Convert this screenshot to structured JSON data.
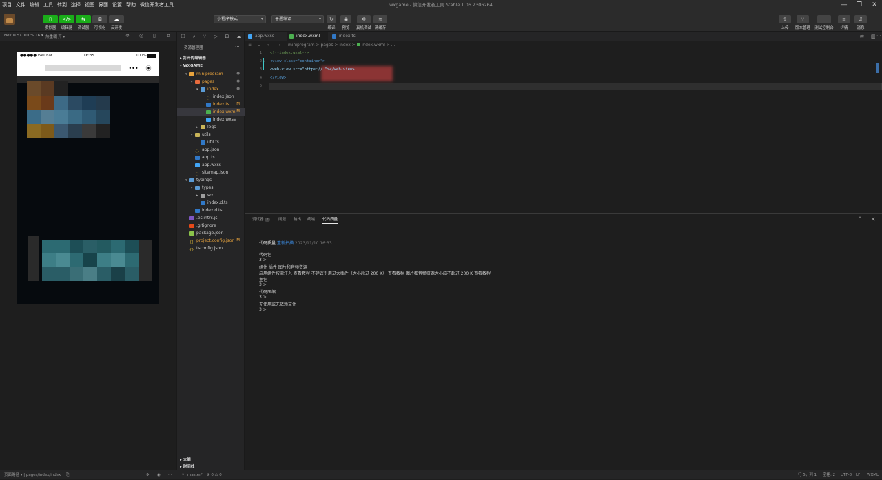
{
  "menu": [
    "项目",
    "文件",
    "编辑",
    "工具",
    "转到",
    "选择",
    "视图",
    "界面",
    "设置",
    "帮助",
    "微信开发者工具"
  ],
  "window_title": "wxgame - 微信开发者工具 Stable 1.06.2306264",
  "window_controls": [
    "—",
    "❐",
    "✕"
  ],
  "toolbar": {
    "left_buttons": [
      {
        "label": "模拟器",
        "icon": "phone-icon",
        "color": "#1aad19"
      },
      {
        "label": "编辑器",
        "icon": "code-icon",
        "color": "#1aad19"
      },
      {
        "label": "调试器",
        "icon": "debug-icon",
        "color": "#1aad19"
      },
      {
        "label": "可视化",
        "icon": "grid-icon",
        "color": "#444444"
      },
      {
        "label": "云开发",
        "icon": "cloud-icon",
        "color": "#444444"
      }
    ],
    "mode_select": "小程序模式",
    "compile_select": "普通编译",
    "mid_buttons": [
      "编译",
      "预览",
      "真机调试",
      "清缓存"
    ],
    "right_buttons": [
      "上传",
      "版本管理",
      "测试控制台",
      "详情",
      "消息"
    ]
  },
  "simulator": {
    "device": "Nexus 5X 100% 16 ▾",
    "hot_reload": "热重载 开 ▾",
    "status_carrier": "●●●●● WeChat",
    "status_time": "16:35",
    "status_battery": "100%",
    "capsule_more": "•••",
    "capsule_close": "⦿"
  },
  "explorer": {
    "title": "资源管理器",
    "open_editors": "打开的编辑器",
    "project": "WXGAME",
    "tree": [
      {
        "name": "miniprogram",
        "depth": 1,
        "twisty": "▾",
        "icon": "folder",
        "color": "#e8a33d",
        "badge": "●",
        "text_color": "#e8a33d"
      },
      {
        "name": "pages",
        "depth": 2,
        "twisty": "▾",
        "icon": "folder",
        "color": "#e86b3d",
        "badge": "●",
        "text_color": "#e8a33d"
      },
      {
        "name": "index",
        "depth": 3,
        "twisty": "▾",
        "icon": "folder",
        "color": "#5b9bd5",
        "badge": "●",
        "text_color": "#e8a33d"
      },
      {
        "name": "index.json",
        "depth": 4,
        "twisty": "",
        "icon": "json",
        "color": "#d9b53a",
        "badge": "",
        "text_color": "#cccccc"
      },
      {
        "name": "index.ts",
        "depth": 4,
        "twisty": "",
        "icon": "ts",
        "color": "#3178c6",
        "badge": "M",
        "text_color": "#e8a33d"
      },
      {
        "name": "index.wxml",
        "depth": 4,
        "twisty": "",
        "icon": "wxml",
        "color": "#4caf50",
        "badge": "M",
        "text_color": "#e8a33d",
        "selected": true
      },
      {
        "name": "index.wxss",
        "depth": 4,
        "twisty": "",
        "icon": "wxss",
        "color": "#42a5f5",
        "badge": "",
        "text_color": "#cccccc"
      },
      {
        "name": "logs",
        "depth": 3,
        "twisty": "▸",
        "icon": "folder",
        "color": "#c9b458",
        "badge": "",
        "text_color": "#cccccc"
      },
      {
        "name": "utils",
        "depth": 2,
        "twisty": "▾",
        "icon": "folder",
        "color": "#c9b458",
        "badge": "",
        "text_color": "#cccccc"
      },
      {
        "name": "util.ts",
        "depth": 3,
        "twisty": "",
        "icon": "ts",
        "color": "#3178c6",
        "badge": "",
        "text_color": "#cccccc"
      },
      {
        "name": "app.json",
        "depth": 2,
        "twisty": "",
        "icon": "json",
        "color": "#d9b53a",
        "badge": "",
        "text_color": "#cccccc"
      },
      {
        "name": "app.ts",
        "depth": 2,
        "twisty": "",
        "icon": "ts",
        "color": "#3178c6",
        "badge": "",
        "text_color": "#cccccc"
      },
      {
        "name": "app.wxss",
        "depth": 2,
        "twisty": "",
        "icon": "wxss",
        "color": "#42a5f5",
        "badge": "",
        "text_color": "#cccccc"
      },
      {
        "name": "sitemap.json",
        "depth": 2,
        "twisty": "",
        "icon": "json",
        "color": "#d9b53a",
        "badge": "",
        "text_color": "#cccccc"
      },
      {
        "name": "typings",
        "depth": 1,
        "twisty": "▾",
        "icon": "folder",
        "color": "#5b9bd5",
        "badge": "",
        "text_color": "#cccccc"
      },
      {
        "name": "types",
        "depth": 2,
        "twisty": "▾",
        "icon": "folder",
        "color": "#5b9bd5",
        "badge": "",
        "text_color": "#cccccc"
      },
      {
        "name": "wx",
        "depth": 3,
        "twisty": "▸",
        "icon": "folder",
        "color": "#9e9e9e",
        "badge": "",
        "text_color": "#cccccc"
      },
      {
        "name": "index.d.ts",
        "depth": 3,
        "twisty": "",
        "icon": "ts",
        "color": "#3178c6",
        "badge": "",
        "text_color": "#cccccc"
      },
      {
        "name": "index.d.ts",
        "depth": 2,
        "twisty": "",
        "icon": "ts",
        "color": "#3178c6",
        "badge": "",
        "text_color": "#cccccc"
      },
      {
        "name": ".eslintrc.js",
        "depth": 1,
        "twisty": "",
        "icon": "eslint",
        "color": "#7e57c2",
        "badge": "",
        "text_color": "#cccccc"
      },
      {
        "name": ".gitignore",
        "depth": 1,
        "twisty": "",
        "icon": "git",
        "color": "#e64a19",
        "badge": "",
        "text_color": "#cccccc"
      },
      {
        "name": "package.json",
        "depth": 1,
        "twisty": "",
        "icon": "npm",
        "color": "#8bc34a",
        "badge": "",
        "text_color": "#cccccc"
      },
      {
        "name": "project.config.json",
        "depth": 1,
        "twisty": "",
        "icon": "json",
        "color": "#d9b53a",
        "badge": "M",
        "text_color": "#e8a33d"
      },
      {
        "name": "tsconfig.json",
        "depth": 1,
        "twisty": "",
        "icon": "json",
        "color": "#d9b53a",
        "badge": "",
        "text_color": "#cccccc"
      }
    ],
    "outline": "大纲",
    "timeline": "时间线"
  },
  "tabs": [
    {
      "label": "app.wxss",
      "color": "#42a5f5",
      "active": false
    },
    {
      "label": "index.wxml",
      "color": "#4caf50",
      "active": true
    },
    {
      "label": "index.ts",
      "color": "#3178c6",
      "active": false
    }
  ],
  "breadcrumb": [
    "miniprogram",
    "pages",
    "index",
    "index.wxml",
    "..."
  ],
  "code": [
    {
      "n": "1",
      "text": "<!--index.wxml-->",
      "color": "#6a9955"
    },
    {
      "n": "2",
      "text": "<view class=\"container\">",
      "color": "#569cd6"
    },
    {
      "n": "3",
      "text": "  <web-view src=\"https://                        \"></web-view>",
      "color": "#9cdcfe"
    },
    {
      "n": "4",
      "text": "</view>",
      "color": "#569cd6"
    },
    {
      "n": "5",
      "text": "",
      "color": "#cfcfcf"
    }
  ],
  "panel": {
    "tabs": [
      "调试器",
      "问题",
      "输出",
      "终端",
      "代码质量"
    ],
    "debugger_badge": "2",
    "heading": "代码质量",
    "rescan": "重新扫描",
    "date": "2023/11/10 16:33",
    "lines": [
      "代码包",
      "3 >",
      "组件                                   插件                                          图片和音频资源",
      "启用组件按需注入 查看教程 不建议引用过大插件（大小超过 200 K） 查看教程 图片和音频资源大小应不超过 200 K 查看教程",
      "主包",
      "3 >",
      "代码压缩",
      "3 >",
      "无使用或无依赖文件",
      "3 >"
    ]
  },
  "statusbar": {
    "left_path": "页面路径 ▾ | pages/index/index",
    "branch": "master*",
    "errors": "⊗ 0 ⚠ 0",
    "position": "行 5，列 1",
    "spaces": "空格: 2",
    "encoding": "UTF-8",
    "eol": "LF",
    "lang": "WXML"
  }
}
